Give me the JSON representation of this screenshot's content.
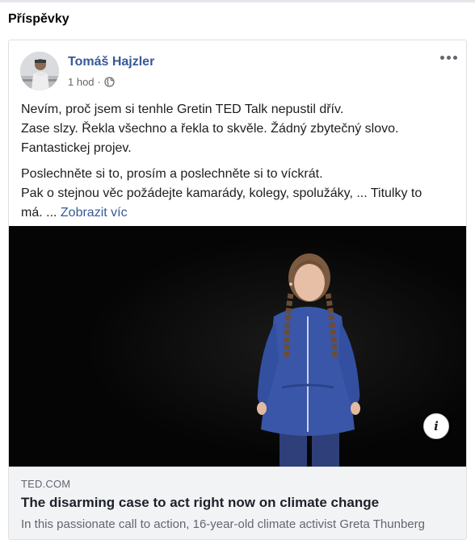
{
  "section": {
    "title": "Příspěvky"
  },
  "post": {
    "author": "Tomáš Hajzler",
    "time": "1 hod",
    "separator": "·",
    "privacy_icon": "globe-icon",
    "more_icon": "more-horizontal-icon",
    "text": {
      "line1": "Nevím, proč jsem si tenhle Gretin TED Talk nepustil dřív.",
      "line2": "Zase slzy. Řekla všechno a řekla to skvěle. Žádný zbytečný slovo.",
      "line3": "Fantastickej projev.",
      "line4": "Poslechněte si to, prosím a poslechněte si to víckrát.",
      "line5": "Pak o stejnou věc požádejte kamarády, kolegy, spolužáky, ... Titulky to",
      "line6": "má. ...",
      "see_more": "Zobrazit víc"
    },
    "link": {
      "domain": "TED.COM",
      "title": "The disarming case to act right now on climate change",
      "description": "In this passionate call to action, 16-year-old climate activist Greta Thunberg"
    },
    "info_icon": "i"
  },
  "colors": {
    "link_blue": "#385898",
    "text_dark": "#1c1e21",
    "muted": "#65676b",
    "link_box_bg": "#f2f3f5"
  }
}
